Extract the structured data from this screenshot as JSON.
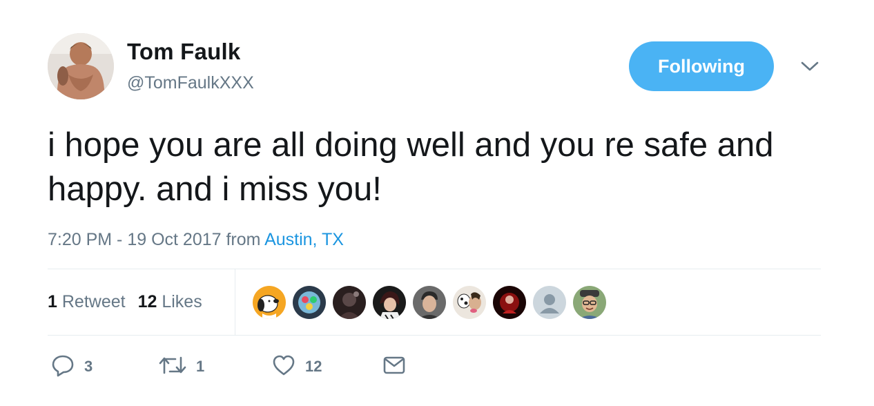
{
  "author": {
    "display_name": "Tom Faulk",
    "handle": "@TomFaulkXXX"
  },
  "follow_button": {
    "label": "Following"
  },
  "tweet": {
    "text": "i hope you are all doing well and you re safe and happy. and i miss you!",
    "time": "7:20 PM - 19 Oct 2017",
    "from_label": "from",
    "location": "Austin, TX"
  },
  "stats": {
    "retweets_count": "1",
    "retweets_label": "Retweet",
    "likes_count": "12",
    "likes_label": "Likes"
  },
  "likers": [
    {
      "name": "snoopy-avatar",
      "bg": "#f5a623"
    },
    {
      "name": "colorful-avatar",
      "bg": "#3a4a5a"
    },
    {
      "name": "dark-avatar",
      "bg": "#3b2b2b"
    },
    {
      "name": "person-avatar",
      "bg": "#4a3a3a"
    },
    {
      "name": "gray-person-avatar",
      "bg": "#5a5a5a"
    },
    {
      "name": "dogs-avatar",
      "bg": "#e8e3dc"
    },
    {
      "name": "red-avatar",
      "bg": "#2a0a0a"
    },
    {
      "name": "default-avatar",
      "bg": "#ccd6dd"
    },
    {
      "name": "smiling-man-avatar",
      "bg": "#7a9a6a"
    }
  ],
  "actions": {
    "reply_count": "3",
    "retweet_count": "1",
    "like_count": "12"
  },
  "colors": {
    "accent": "#1b95e0",
    "follow_button_bg": "#4ab3f4",
    "muted_text": "#657786",
    "primary_text": "#14171a",
    "divider": "#e6ecf0"
  },
  "icons": {
    "chevron": "chevron-down-icon",
    "reply": "reply-icon",
    "retweet": "retweet-icon",
    "like": "heart-icon",
    "message": "envelope-icon"
  }
}
